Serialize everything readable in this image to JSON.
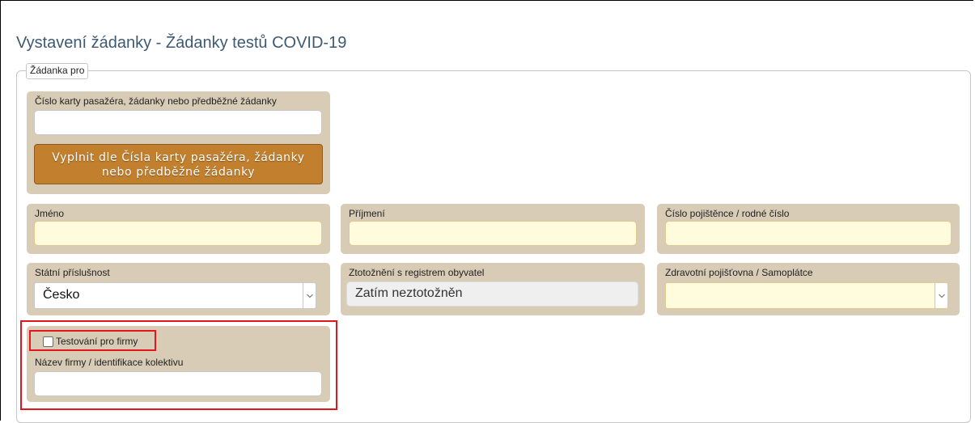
{
  "page": {
    "title": "Vystavení žádanky - Žádanky testů COVID-19"
  },
  "form": {
    "legend": "Žádanka pro",
    "passenger_card": {
      "label": "Číslo karty pasažéra, žádanky nebo předběžné žádanky",
      "value": "",
      "button_line1": "Vyplnit dle Čísla karty pasažéra, žádanky",
      "button_line2": "nebo předběžné žádanky"
    },
    "first_name": {
      "label": "Jméno",
      "value": ""
    },
    "last_name": {
      "label": "Příjmení",
      "value": ""
    },
    "insurance_number": {
      "label": "Číslo pojištěnce / rodné číslo",
      "value": ""
    },
    "nationality": {
      "label": "Státní příslušnost",
      "selected": "Česko"
    },
    "registry": {
      "label": "Ztotožnění s registrem obyvatel",
      "value": "Zatím neztotožněn"
    },
    "insurer": {
      "label": "Zdravotní pojišťovna / Samoplátce",
      "selected": ""
    },
    "company_testing": {
      "checkbox_label": "Testování pro firmy",
      "checked": false,
      "company_label": "Název firmy / identifikace kolektivu",
      "company_value": ""
    }
  },
  "colors": {
    "panel": "#d8ccb6",
    "required_field": "#fffbdc",
    "button": "#c27f2d",
    "highlight": "#e3161c"
  }
}
